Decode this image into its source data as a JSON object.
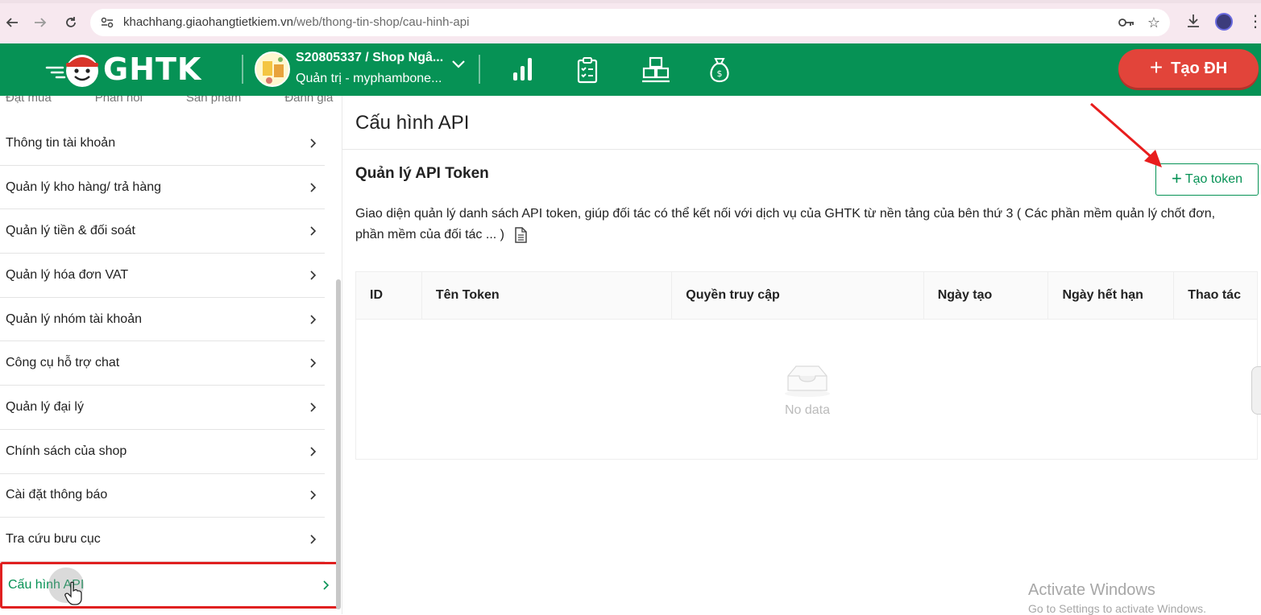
{
  "browser": {
    "url_host": "khachhang.giaohangtietkiem.vn",
    "url_path": "/web/thong-tin-shop/cau-hinh-api"
  },
  "header": {
    "logo_text": "GHTK",
    "shop_name": "S20805337 / Shop Ngâ...",
    "shop_role": "Quản trị - myphambone...",
    "create_order_label": "Tạo ĐH",
    "brand_color": "#069255",
    "create_order_color": "#e2443a"
  },
  "sidebar": {
    "cut_tabs": [
      "Đặt mua",
      "Phản hồi",
      "Sản phẩm",
      "Đánh giá"
    ],
    "items": [
      {
        "label": "Thông tin tài khoản"
      },
      {
        "label": "Quản lý kho hàng/ trả hàng"
      },
      {
        "label": "Quản lý tiền & đối soát"
      },
      {
        "label": "Quản lý hóa đơn VAT"
      },
      {
        "label": "Quản lý nhóm tài khoản"
      },
      {
        "label": "Công cụ hỗ trợ chat"
      },
      {
        "label": "Quản lý đại lý"
      },
      {
        "label": "Chính sách của shop"
      },
      {
        "label": "Cài đặt thông báo"
      },
      {
        "label": "Tra cứu bưu cục"
      },
      {
        "label": "Cấu hình API"
      }
    ],
    "active_index": 10
  },
  "main": {
    "page_title": "Cấu hình API",
    "section_title": "Quản lý API Token",
    "create_token_label": "Tạo token",
    "description": "Giao diện quản lý danh sách API token, giúp đối tác có thể kết nối với dịch vụ của GHTK từ nền tảng của bên thứ 3 ( Các phần mềm quản lý chốt đơn, phần mềm của đối tác ... )",
    "table": {
      "columns": [
        "ID",
        "Tên Token",
        "Quyền truy cập",
        "Ngày tạo",
        "Ngày hết hạn",
        "Thao tác"
      ],
      "empty_text": "No data"
    }
  },
  "watermark": {
    "line1": "Activate Windows",
    "line2": "Go to Settings to activate Windows."
  }
}
